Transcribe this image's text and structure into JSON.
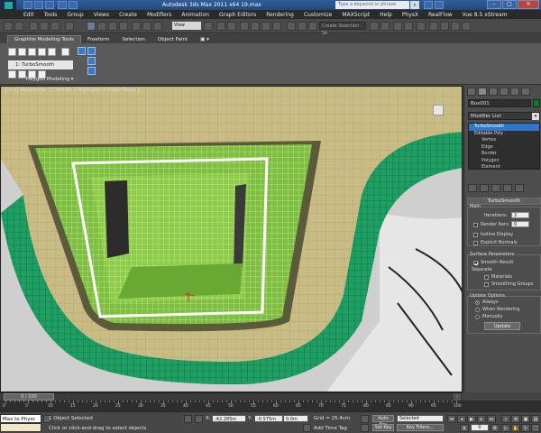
{
  "window": {
    "title": "Autodesk 3ds Max  2011 x64        19.max",
    "search_placeholder": "Type a keyword or phrase"
  },
  "menu": [
    "Edit",
    "Tools",
    "Group",
    "Views",
    "Create",
    "Modifiers",
    "Animation",
    "Graph Editors",
    "Rendering",
    "Customize",
    "MAXScript",
    "Help",
    "PhysX",
    "RealFlow",
    "Vue 8.5 xStream"
  ],
  "toolbar": {
    "view_dropdown": "View",
    "selection_set": "Create Selection Se"
  },
  "ribbon": {
    "tabs": [
      "Graphite Modeling Tools",
      "Freeform",
      "Selection",
      "Object Paint"
    ],
    "active_tab": "Graphite Modeling Tools",
    "current_modifier": "1: TurboSmooth",
    "group_label": "Polygon Modeling ▾"
  },
  "viewport": {
    "label": "[ + ] [ Perspective ] [ Smooth + Highlights + Edged Faces ]"
  },
  "command_panel": {
    "object_name": "Box001",
    "modifier_list": "Modifier List",
    "stack": [
      {
        "label": "TurboSmooth",
        "selected": true,
        "sub": false
      },
      {
        "label": "Editable Poly",
        "selected": false,
        "sub": false
      },
      {
        "label": "Vertex",
        "selected": false,
        "sub": true
      },
      {
        "label": "Edge",
        "selected": false,
        "sub": true
      },
      {
        "label": "Border",
        "selected": false,
        "sub": true
      },
      {
        "label": "Polygon",
        "selected": false,
        "sub": true
      },
      {
        "label": "Element",
        "selected": false,
        "sub": true
      }
    ],
    "turbosmooth": {
      "title": "TurboSmooth",
      "main_label": "Main",
      "iterations_label": "Iterations:",
      "iterations": "2",
      "render_iters_label": "Render Iters:",
      "render_iters": "0",
      "isoline_display": "Isoline Display",
      "explicit_normals": "Explicit Normals",
      "surface_params_label": "Surface Parameters",
      "smooth_result": "Smooth Result",
      "separate_label": "Separate",
      "materials": "Materials",
      "smoothing_groups": "Smoothing Groups",
      "update_options_label": "Update Options",
      "always": "Always",
      "when_rendering": "When Rendering",
      "manually": "Manually",
      "update_button": "Update"
    }
  },
  "timeline": {
    "slider": "0 / 100",
    "ticks": [
      "0",
      "5",
      "10",
      "15",
      "20",
      "25",
      "30",
      "35",
      "40",
      "45",
      "50",
      "55",
      "60",
      "65",
      "70",
      "75",
      "80",
      "85",
      "90",
      "95",
      "100"
    ],
    "progress": 0.0
  },
  "statusbar": {
    "maxscript": "Max to Physc",
    "selection_status": "1 Object Selected",
    "prompt": "Click or click-and-drag to select objects",
    "x_label": "X:",
    "x": "-42.285m",
    "y_label": "Y:",
    "y": "-0.575m",
    "z_label": "Z:",
    "z": "0.0m",
    "grid": "Grid = 25.4cm",
    "add_time_tag": "Add Time Tag",
    "auto_key": "Auto Key",
    "set_key": "Set Key",
    "selected_dropdown": "Selected",
    "key_filters": "Key Filters...",
    "frame": "0"
  },
  "colors": {
    "accent_blue": "#2f78c9",
    "object_color": "#0b7a2a",
    "mesh_green": "#7fbf3f",
    "border_green": "#1e9e62",
    "tan_surface": "#c8bb84"
  }
}
